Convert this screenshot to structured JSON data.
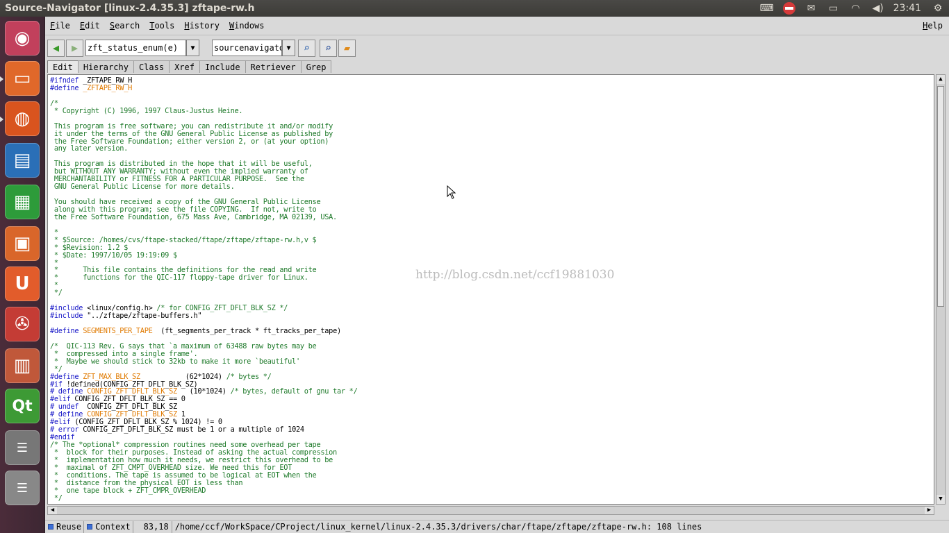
{
  "panel": {
    "window_title": "Source-Navigator [linux-2.4.35.3] zftape-rw.h",
    "clock": "23:41",
    "icons": [
      "keyboard-icon",
      "no-entry-icon",
      "mail-icon",
      "battery-icon",
      "wifi-icon",
      "volume-icon",
      "power-gear-icon"
    ]
  },
  "launcher": {
    "items": [
      {
        "name": "ubuntu-dash",
        "glyph": "◉",
        "color": "#c2405c"
      },
      {
        "name": "files",
        "glyph": "▭",
        "color": "#e0682a"
      },
      {
        "name": "firefox",
        "glyph": "◍",
        "color": "#d9541e"
      },
      {
        "name": "libreoffice-writer",
        "glyph": "▤",
        "color": "#2a6fb7"
      },
      {
        "name": "libreoffice-calc",
        "glyph": "▦",
        "color": "#2d9b3a"
      },
      {
        "name": "software-center",
        "glyph": "▣",
        "color": "#d9662a"
      },
      {
        "name": "ubuntu-one",
        "glyph": "U",
        "color": "#e25c2b"
      },
      {
        "name": "system-settings",
        "glyph": "✇",
        "color": "#c43c35"
      },
      {
        "name": "libreoffice-impress",
        "glyph": "▥",
        "color": "#c0583a"
      },
      {
        "name": "qt-creator",
        "glyph": "Qt",
        "color": "#3d9a35"
      }
    ]
  },
  "menu": {
    "file": "File",
    "edit": "Edit",
    "search": "Search",
    "tools": "Tools",
    "history": "History",
    "windows": "Windows",
    "help": "Help"
  },
  "toolbar": {
    "symbol_combo_value": "zft_status_enum(e)",
    "project_combo_value": "sourcenavigator-l"
  },
  "tabs": [
    "Edit",
    "Hierarchy",
    "Class",
    "Xref",
    "Include",
    "Retriever",
    "Grep"
  ],
  "editor": {
    "lines": [
      [
        [
          "kw",
          "#ifndef "
        ],
        [
          "tx",
          "_ZFTAPE_RW_H"
        ]
      ],
      [
        [
          "kw",
          "#define "
        ],
        [
          "mac",
          "_ZFTAPE_RW_H"
        ]
      ],
      [
        [
          "tx",
          ""
        ]
      ],
      [
        [
          "cm",
          "/*"
        ]
      ],
      [
        [
          "cm",
          " * Copyright (C) 1996, 1997 Claus-Justus Heine."
        ]
      ],
      [
        [
          "tx",
          ""
        ]
      ],
      [
        [
          "cm",
          " This program is free software; you can redistribute it and/or modify"
        ]
      ],
      [
        [
          "cm",
          " it under the terms of the GNU General Public License as published by"
        ]
      ],
      [
        [
          "cm",
          " the Free Software Foundation; either version 2, or (at your option)"
        ]
      ],
      [
        [
          "cm",
          " any later version."
        ]
      ],
      [
        [
          "tx",
          ""
        ]
      ],
      [
        [
          "cm",
          " This program is distributed in the hope that it will be useful,"
        ]
      ],
      [
        [
          "cm",
          " but WITHOUT ANY WARRANTY; without even the implied warranty of"
        ]
      ],
      [
        [
          "cm",
          " MERCHANTABILITY or FITNESS FOR A PARTICULAR PURPOSE.  See the"
        ]
      ],
      [
        [
          "cm",
          " GNU General Public License for more details."
        ]
      ],
      [
        [
          "tx",
          ""
        ]
      ],
      [
        [
          "cm",
          " You should have received a copy of the GNU General Public License"
        ]
      ],
      [
        [
          "cm",
          " along with this program; see the file COPYING.  If not, write to"
        ]
      ],
      [
        [
          "cm",
          " the Free Software Foundation, 675 Mass Ave, Cambridge, MA 02139, USA."
        ]
      ],
      [
        [
          "tx",
          ""
        ]
      ],
      [
        [
          "cm",
          " *"
        ]
      ],
      [
        [
          "cm",
          " * $Source: /homes/cvs/ftape-stacked/ftape/zftape/zftape-rw.h,v $"
        ]
      ],
      [
        [
          "cm",
          " * $Revision: 1.2 $"
        ]
      ],
      [
        [
          "cm",
          " * $Date: 1997/10/05 19:19:09 $"
        ]
      ],
      [
        [
          "cm",
          " *"
        ]
      ],
      [
        [
          "cm",
          " *      This file contains the definitions for the read and write"
        ]
      ],
      [
        [
          "cm",
          " *      functions for the QIC-117 floppy-tape driver for Linux."
        ]
      ],
      [
        [
          "cm",
          " *"
        ]
      ],
      [
        [
          "cm",
          " */"
        ]
      ],
      [
        [
          "tx",
          ""
        ]
      ],
      [
        [
          "kw",
          "#include "
        ],
        [
          "tx",
          "<linux/config.h> "
        ],
        [
          "cm",
          "/* for CONFIG_ZFT_DFLT_BLK_SZ */"
        ]
      ],
      [
        [
          "kw",
          "#include "
        ],
        [
          "tx",
          "\"../zftape/zftape-buffers.h\""
        ]
      ],
      [
        [
          "tx",
          ""
        ]
      ],
      [
        [
          "kw",
          "#define "
        ],
        [
          "mac",
          "SEGMENTS_PER_TAPE"
        ],
        [
          "tx",
          "  (ft_segments_per_track * ft_tracks_per_tape)"
        ]
      ],
      [
        [
          "tx",
          ""
        ]
      ],
      [
        [
          "cm",
          "/*  QIC-113 Rev. G says that `a maximum of 63488 raw bytes may be"
        ]
      ],
      [
        [
          "cm",
          " *  compressed into a single frame'."
        ]
      ],
      [
        [
          "cm",
          " *  Maybe we should stick to 32kb to make it more `beautiful'"
        ]
      ],
      [
        [
          "cm",
          " */"
        ]
      ],
      [
        [
          "kw",
          "#define "
        ],
        [
          "mac",
          "ZFT_MAX_BLK_SZ"
        ],
        [
          "tx",
          "           (62*1024) "
        ],
        [
          "cm",
          "/* bytes */"
        ]
      ],
      [
        [
          "kw",
          "#if "
        ],
        [
          "tx",
          "!defined(CONFIG_ZFT_DFLT_BLK_SZ)"
        ]
      ],
      [
        [
          "kw",
          "# define "
        ],
        [
          "mac",
          "CONFIG_ZFT_DFLT_BLK_SZ"
        ],
        [
          "tx",
          "   (10*1024) "
        ],
        [
          "cm",
          "/* bytes, default of gnu tar */"
        ]
      ],
      [
        [
          "kw",
          "#elif "
        ],
        [
          "tx",
          "CONFIG_ZFT_DFLT_BLK_SZ == 0"
        ]
      ],
      [
        [
          "kw",
          "# undef  "
        ],
        [
          "tx",
          "CONFIG_ZFT_DFLT_BLK_SZ"
        ]
      ],
      [
        [
          "kw",
          "# define "
        ],
        [
          "mac",
          "CONFIG_ZFT_DFLT_BLK_SZ"
        ],
        [
          "tx",
          " 1"
        ]
      ],
      [
        [
          "kw",
          "#elif "
        ],
        [
          "tx",
          "(CONFIG_ZFT_DFLT_BLK_SZ % 1024) != 0"
        ]
      ],
      [
        [
          "kw",
          "# error "
        ],
        [
          "tx",
          "CONFIG_ZFT_DFLT_BLK_SZ must be 1 or a multiple of 1024"
        ]
      ],
      [
        [
          "kw",
          "#endif"
        ]
      ],
      [
        [
          "cm",
          "/* The *optional* compression routines need some overhead per tape"
        ]
      ],
      [
        [
          "cm",
          " *  block for their purposes. Instead of asking the actual compression"
        ]
      ],
      [
        [
          "cm",
          " *  implementation how much it needs, we restrict this overhead to be"
        ]
      ],
      [
        [
          "cm",
          " *  maximal of ZFT_CMPT_OVERHEAD size. We need this for EOT"
        ]
      ],
      [
        [
          "cm",
          " *  conditions. The tape is assumed to be logical at EOT when the"
        ]
      ],
      [
        [
          "cm",
          " *  distance from the physical EOT is less than"
        ]
      ],
      [
        [
          "cm",
          " *  one tape block + ZFT_CMPR_OVERHEAD"
        ]
      ],
      [
        [
          "cm",
          " */"
        ]
      ]
    ]
  },
  "watermark": "http://blog.csdn.net/ccf19881030",
  "status": {
    "reuse_label": "Reuse",
    "context_label": "Context",
    "position": "83,18",
    "file_info": "/home/ccf/WorkSpace/CProject/linux_kernel/linux-2.4.35.3/drivers/char/ftape/zftape/zftape-rw.h: 108 lines"
  }
}
